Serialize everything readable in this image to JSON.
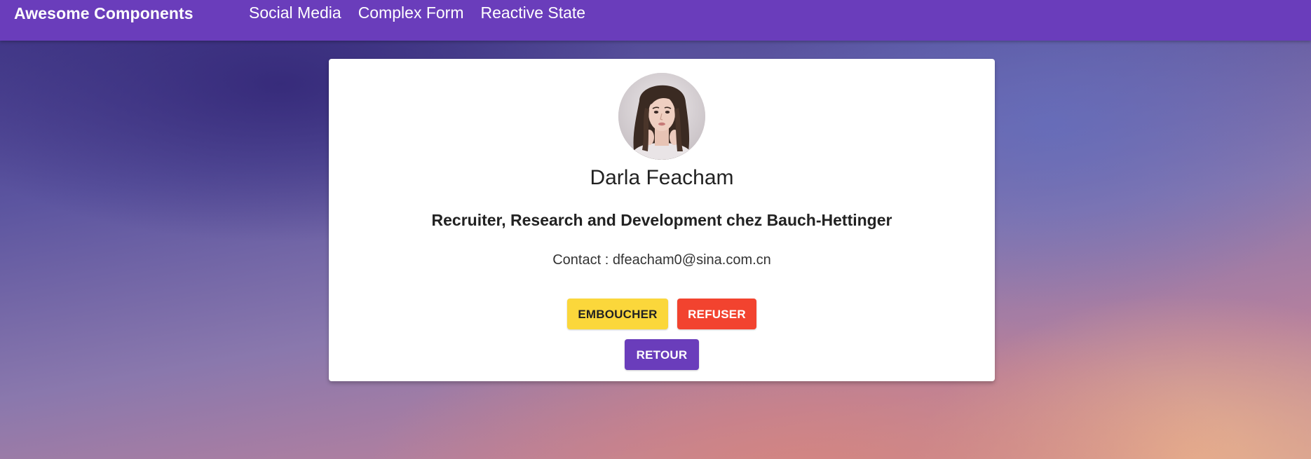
{
  "toolbar": {
    "brand": "Awesome Components",
    "nav": [
      {
        "label": "Social Media"
      },
      {
        "label": "Complex Form"
      },
      {
        "label": "Reactive State"
      }
    ],
    "color": "#6a3dbb"
  },
  "profile": {
    "avatar_icon": "profile-photo",
    "name": "Darla Feacham",
    "title": "Recruiter, Research and Development chez Bauch-Hettinger",
    "contact_label": "Contact",
    "contact_separator": " : ",
    "email": "dfeacham0@sina.com.cn"
  },
  "actions": {
    "accept_label": "EMBOUCHER",
    "refuse_label": "REFUSER",
    "back_label": "RETOUR",
    "colors": {
      "accept": "#fbd73b",
      "refuse": "#f2432f",
      "back": "#6a3dbb"
    }
  }
}
